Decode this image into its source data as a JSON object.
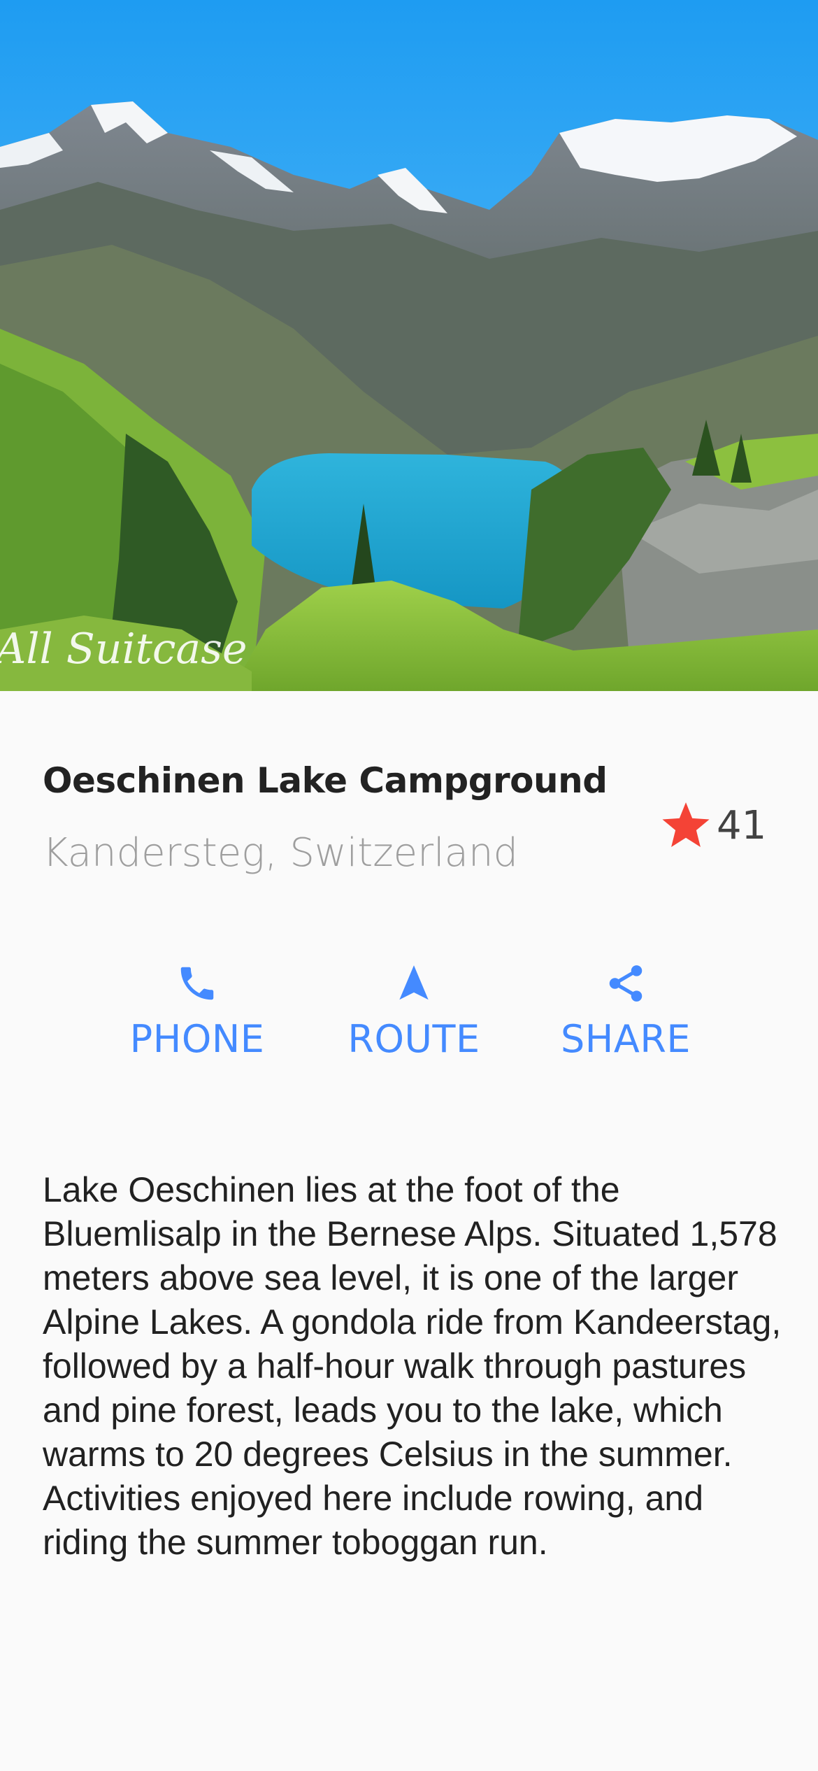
{
  "hero": {
    "image_name": "lake-mountain-photo",
    "watermark": "All Suitcase"
  },
  "title_section": {
    "name": "Oeschinen Lake Campground",
    "location": "Kandersteg, Switzerland",
    "favorite": {
      "icon": "star-icon",
      "count": "41",
      "color": "#f44336"
    }
  },
  "buttons": [
    {
      "label": "PHONE",
      "icon": "phone-icon"
    },
    {
      "label": "ROUTE",
      "icon": "navigation-icon"
    },
    {
      "label": "SHARE",
      "icon": "share-icon"
    }
  ],
  "accent_color": "#448aff",
  "description": "Lake Oeschinen lies at the foot of the Bluemlisalp in the Bernese Alps. Situated 1,578 meters above sea level, it is one of the larger Alpine Lakes. A gondola ride from Kandeerstag, followed by a half-hour walk through pastures and pine forest, leads you to the lake, which warms to 20 degrees Celsius in the summer. Activities enjoyed here include rowing, and riding the summer toboggan run."
}
